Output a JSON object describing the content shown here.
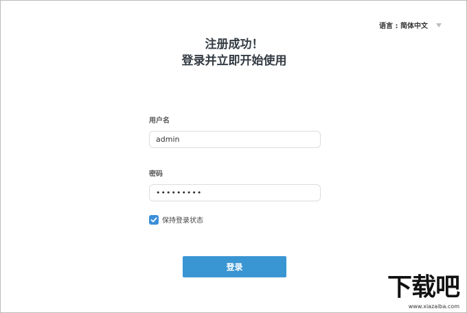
{
  "language": {
    "label": "语言 : 简体中文"
  },
  "header": {
    "line1": "注册成功！",
    "line2": "登录并立即开始使用"
  },
  "form": {
    "username_label": "用户名",
    "username_value": "admin",
    "password_label": "密码",
    "password_value": "•••••••••",
    "remember_label": "保持登录状态",
    "remember_checked": true,
    "submit_label": "登录"
  },
  "watermark": {
    "text": "下载吧",
    "url": "www.xiazaiba.com"
  },
  "colors": {
    "accent": "#3a95d3",
    "checkbox": "#3b8fd9"
  }
}
